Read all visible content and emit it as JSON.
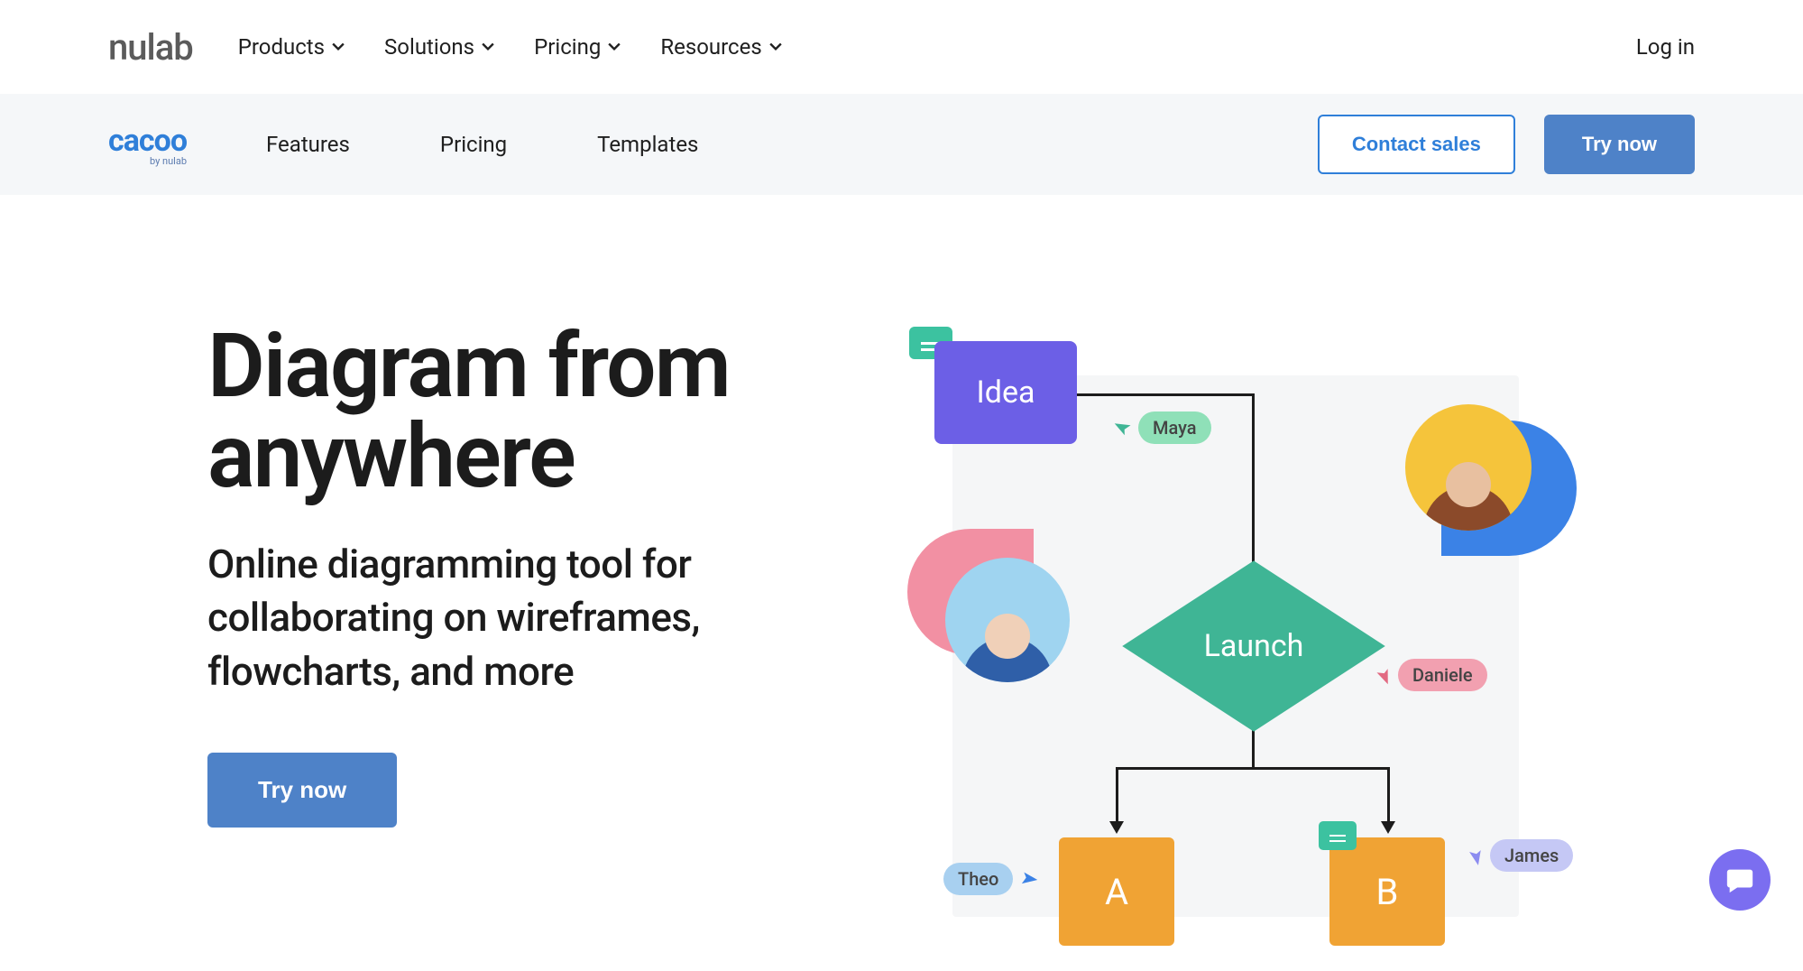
{
  "topnav": {
    "logo": "nulab",
    "menu": [
      "Products",
      "Solutions",
      "Pricing",
      "Resources"
    ],
    "login": "Log in"
  },
  "subnav": {
    "logo": "cacoo",
    "logo_sub": "by nulab",
    "menu": [
      "Features",
      "Pricing",
      "Templates"
    ],
    "contact": "Contact sales",
    "try": "Try now"
  },
  "hero": {
    "title": "Diagram from anywhere",
    "subtitle": "Online diagramming tool for collaborating on wireframes, flowcharts, and more",
    "cta": "Try now"
  },
  "illus": {
    "idea": "Idea",
    "launch": "Launch",
    "a": "A",
    "b": "B",
    "users": {
      "maya": "Maya",
      "daniele": "Daniele",
      "theo": "Theo",
      "james": "James"
    }
  }
}
